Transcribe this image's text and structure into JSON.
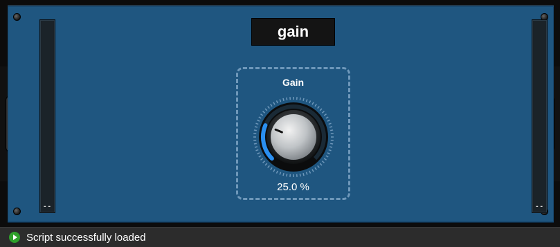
{
  "plugin": {
    "title": "gain",
    "knob": {
      "label": "Gain",
      "value_text": "25.0 %",
      "value_fraction": 0.25,
      "accent_color": "#2a8ff0"
    },
    "meters": {
      "left_value": "--",
      "right_value": "--"
    }
  },
  "status": {
    "icon": "play-icon",
    "icon_color": "#2fa02b",
    "message": "Script successfully loaded"
  },
  "colors": {
    "panel": "#1f5680",
    "background": "#0c0c0c"
  }
}
